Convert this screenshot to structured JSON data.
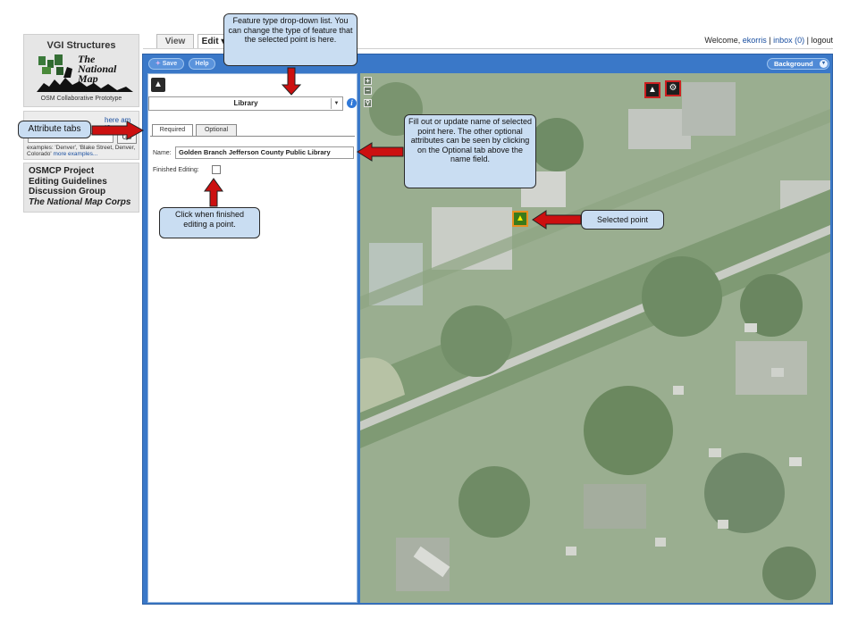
{
  "sidebar": {
    "logo_title": "VGI Structures",
    "logo_text": "The\nNational\nMap",
    "logo_subtitle": "OSM Collaborative Prototype",
    "where_am_i": "here am I?",
    "go_label": "Go",
    "search_examples": "examples: 'Denver', 'Blake Street, Denver, Colorado'",
    "more_examples": "more examples...",
    "links": [
      "OSMCP Project",
      "Editing Guidelines",
      "Discussion Group",
      "The National Map Corps"
    ]
  },
  "header": {
    "tabs": [
      "View",
      "Edit ▾"
    ],
    "welcome_prefix": "Welcome,",
    "username": "ekorris",
    "inbox": "inbox (0)",
    "logout": "logout"
  },
  "toolbar": {
    "save_label": "Save",
    "help_label": "Help",
    "background_label": "Background",
    "background_caret": "▾"
  },
  "editor": {
    "feature_type": "Library",
    "attr_tabs": [
      "Required",
      "Optional"
    ],
    "name_label": "Name:",
    "name_value": "Golden Branch Jefferson County Public Library",
    "finished_label": "Finished Editing:"
  },
  "callouts": {
    "feature_type": "Feature type drop-down list. You can change the type of feature that the selected point is here.",
    "attribute_tabs": "Attribute tabs",
    "fill_name": "Fill out or update name of selected point here. The other optional attributes can be seen by clicking on the Optional tab above the name field.",
    "finished": "Click when finished editing a point.",
    "selected_point": "Selected point"
  },
  "colors": {
    "editor_blue": "#3a78c8",
    "callout_fill": "#c9ddf2",
    "arrow_red": "#cc1010",
    "link_blue": "#1a4fa0"
  },
  "icons": {
    "feature_type": "library-icon",
    "info": "info-icon",
    "map_poi_1": "library-poi-icon",
    "map_poi_2": "gear-poi-icon",
    "selected_poi": "library-poi-icon"
  }
}
